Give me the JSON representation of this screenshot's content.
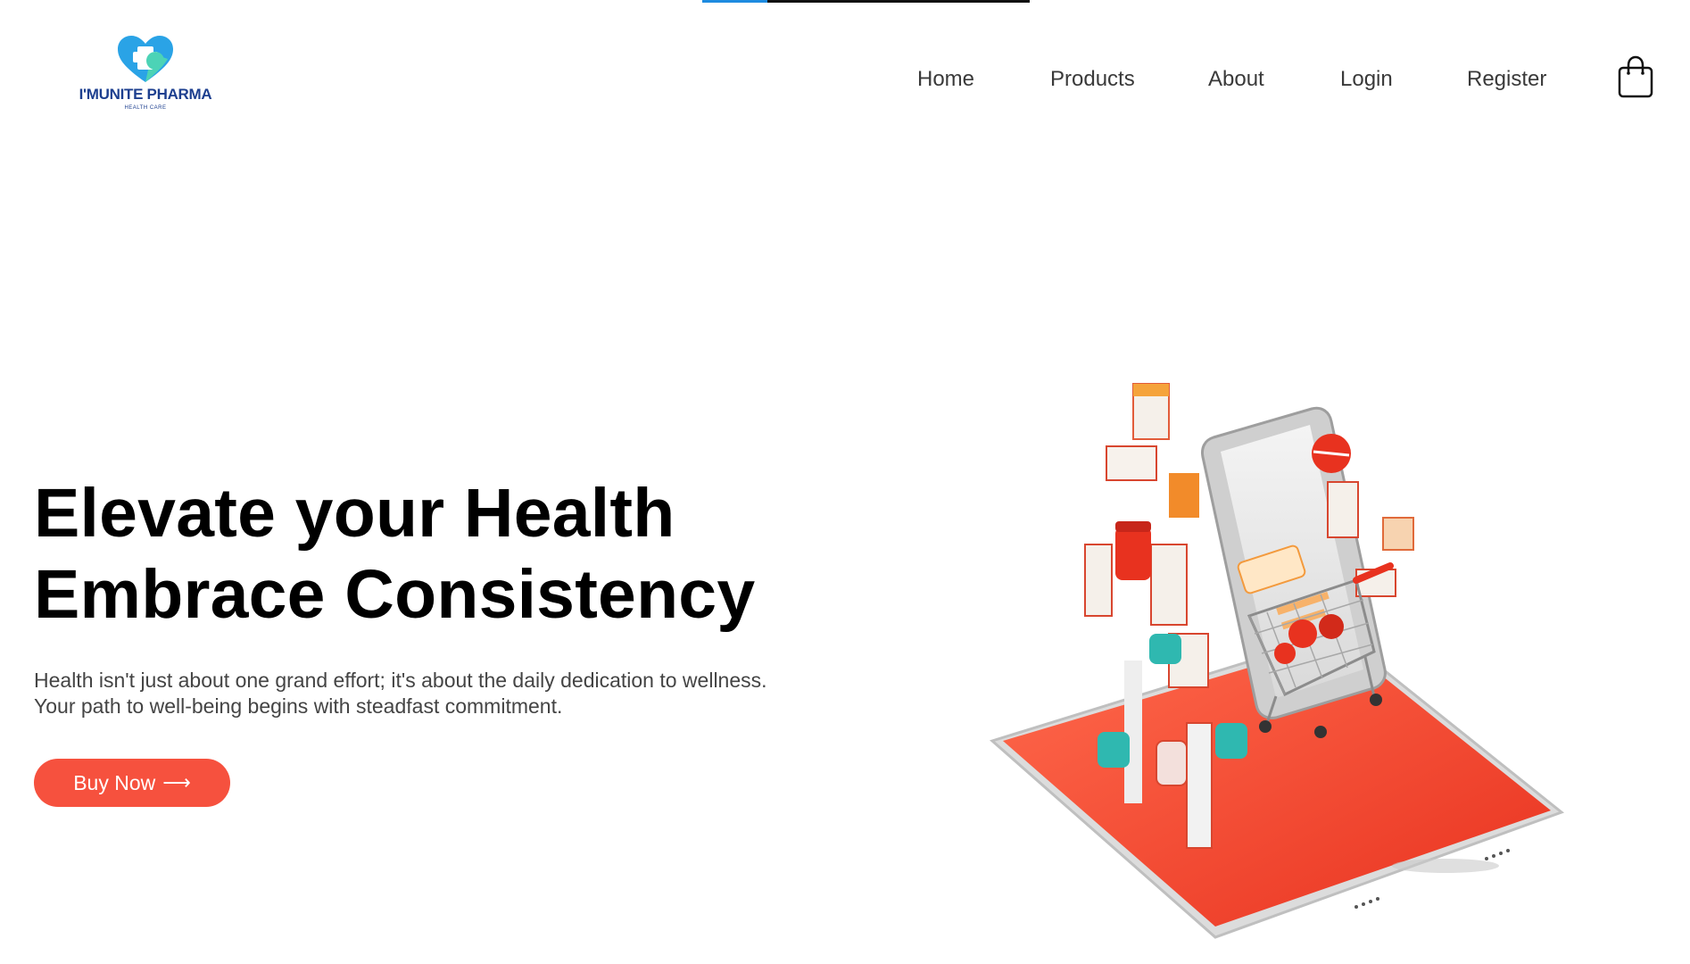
{
  "page_loader": {
    "progress": 0.2,
    "fill_color": "#1e8be0",
    "track_color": "#111111"
  },
  "brand": {
    "name": "I'MUNITE PHARMA",
    "tagline": "HEALTH CARE",
    "logo_icon": "heart-cross-icon",
    "colors": {
      "primary": "#1d3f8f",
      "heart_blue": "#2aa3e6",
      "heart_teal": "#4cd3b6"
    }
  },
  "nav": {
    "items": [
      {
        "label": "Home"
      },
      {
        "label": "Products"
      },
      {
        "label": "About"
      },
      {
        "label": "Login"
      },
      {
        "label": "Register"
      }
    ],
    "cart_icon": "shopping-bag-icon"
  },
  "hero": {
    "title_line1": "Elevate your Health",
    "title_line2": "Embrace Consistency",
    "text_line1": "Health isn't just about one grand effort; it's about the daily dedication to wellness.",
    "text_line2": "Your path to well-being begins with steadfast commitment.",
    "cta_label": "Buy Now",
    "cta_arrow": "⟶",
    "cta_color": "#f6513e",
    "illustration": "smartphone-pharmacy-shopping-cart-illustration"
  }
}
